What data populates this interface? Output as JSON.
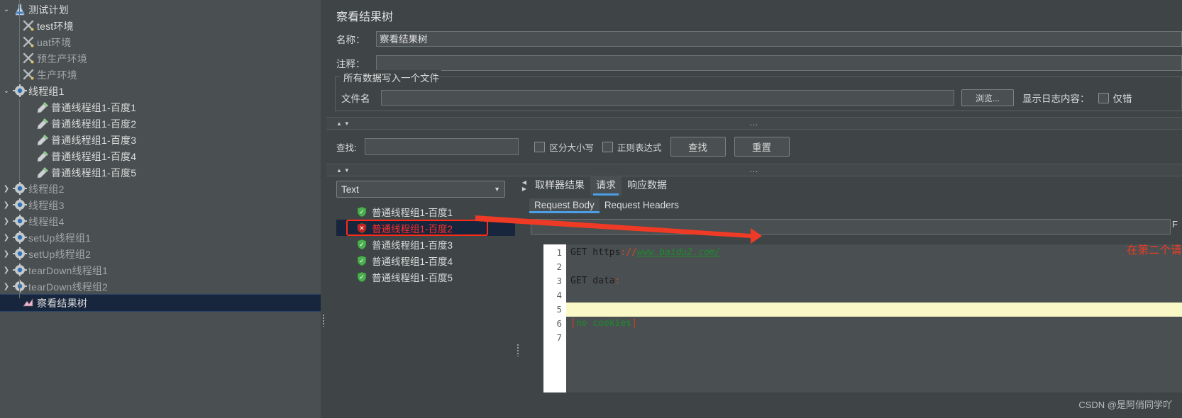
{
  "tree": {
    "items": [
      {
        "label": "测试计划",
        "icon": "flask-icon",
        "indent": 0,
        "twisty": "open",
        "dim": false,
        "selected": false
      },
      {
        "label": "test环境",
        "icon": "wrench-screwdriver-icon",
        "indent": 1,
        "twisty": "",
        "dim": false,
        "selected": false
      },
      {
        "label": "uat环境",
        "icon": "wrench-screwdriver-icon",
        "indent": 1,
        "twisty": "",
        "dim": true,
        "selected": false
      },
      {
        "label": "预生产环境",
        "icon": "wrench-screwdriver-icon",
        "indent": 1,
        "twisty": "",
        "dim": true,
        "selected": false
      },
      {
        "label": "生产环境",
        "icon": "wrench-screwdriver-icon",
        "indent": 1,
        "twisty": "",
        "dim": true,
        "selected": false
      },
      {
        "label": "线程组1",
        "icon": "gear-icon",
        "indent": 0,
        "twisty": "open",
        "dim": false,
        "selected": false
      },
      {
        "label": "普通线程组1-百度1",
        "icon": "pipette-icon",
        "indent": 2,
        "twisty": "",
        "dim": false,
        "selected": false
      },
      {
        "label": "普通线程组1-百度2",
        "icon": "pipette-icon",
        "indent": 2,
        "twisty": "",
        "dim": false,
        "selected": false
      },
      {
        "label": "普通线程组1-百度3",
        "icon": "pipette-icon",
        "indent": 2,
        "twisty": "",
        "dim": false,
        "selected": false
      },
      {
        "label": "普通线程组1-百度4",
        "icon": "pipette-icon",
        "indent": 2,
        "twisty": "",
        "dim": false,
        "selected": false
      },
      {
        "label": "普通线程组1-百度5",
        "icon": "pipette-icon",
        "indent": 2,
        "twisty": "",
        "dim": false,
        "selected": false
      },
      {
        "label": "线程组2",
        "icon": "gear-icon",
        "indent": 0,
        "twisty": "closed",
        "dim": true,
        "selected": false
      },
      {
        "label": "线程组3",
        "icon": "gear-icon",
        "indent": 0,
        "twisty": "closed",
        "dim": true,
        "selected": false
      },
      {
        "label": "线程组4",
        "icon": "gear-icon",
        "indent": 0,
        "twisty": "closed",
        "dim": true,
        "selected": false
      },
      {
        "label": "setUp线程组1",
        "icon": "gear-icon",
        "indent": 0,
        "twisty": "closed",
        "dim": true,
        "selected": false
      },
      {
        "label": "setUp线程组2",
        "icon": "gear-icon",
        "indent": 0,
        "twisty": "closed",
        "dim": true,
        "selected": false
      },
      {
        "label": "tearDown线程组1",
        "icon": "gear-icon",
        "indent": 0,
        "twisty": "closed",
        "dim": true,
        "selected": false
      },
      {
        "label": "tearDown线程组2",
        "icon": "gear-icon",
        "indent": 0,
        "twisty": "closed",
        "dim": true,
        "selected": false
      },
      {
        "label": "察看结果树",
        "icon": "result-tree-icon",
        "indent": 1,
        "twisty": "",
        "dim": false,
        "selected": true
      }
    ]
  },
  "panel": {
    "title": "察看结果树",
    "name_label": "名称：",
    "name_value": "察看结果树",
    "comment_label": "注释：",
    "comment_value": "",
    "groupbox_title": "所有数据写入一个文件",
    "filename_label": "文件名",
    "filename_value": "",
    "browse_button": "浏览...",
    "log_display_label": "显示日志内容：",
    "only_error_label": "仅错"
  },
  "search": {
    "label": "查找:",
    "value": "",
    "case_sensitive_label": "区分大小写",
    "regex_label": "正则表达式",
    "find_button": "查找",
    "reset_button": "重置",
    "ellipsis": "..."
  },
  "renderer": {
    "selected": "Text",
    "caret": "▼"
  },
  "results": [
    {
      "label": "普通线程组1-百度1",
      "status": "success"
    },
    {
      "label": "普通线程组1-百度2",
      "status": "error"
    },
    {
      "label": "普通线程组1-百度3",
      "status": "success"
    },
    {
      "label": "普通线程组1-百度4",
      "status": "success"
    },
    {
      "label": "普通线程组1-百度5",
      "status": "success"
    }
  ],
  "tabs": {
    "main": [
      {
        "label": "取样器结果",
        "active": false
      },
      {
        "label": "请求",
        "active": true
      },
      {
        "label": "响应数据",
        "active": false
      }
    ],
    "sub": [
      {
        "label": "Request Body",
        "active": true
      },
      {
        "label": "Request Headers",
        "active": false
      }
    ]
  },
  "request": {
    "find_label": "F",
    "input_value": "",
    "line_numbers": [
      "1",
      "2",
      "3",
      "4",
      "5",
      "6",
      "7"
    ],
    "lines": [
      {
        "n": "1",
        "text": "GET https://www.baidu2.com/",
        "type": "url",
        "highlight": false
      },
      {
        "n": "2",
        "text": "",
        "type": "plain",
        "highlight": false
      },
      {
        "n": "3",
        "text": "GET data:",
        "type": "kv",
        "highlight": false
      },
      {
        "n": "4",
        "text": "",
        "type": "plain",
        "highlight": false
      },
      {
        "n": "5",
        "text": "",
        "type": "plain",
        "highlight": true
      },
      {
        "n": "6",
        "text": "[no cookies]",
        "type": "cookie",
        "highlight": false
      },
      {
        "n": "7",
        "text": "",
        "type": "plain",
        "highlight": false
      }
    ],
    "url_method": "GET https",
    "url_colon": "://",
    "url_host": "www.baidu2.com/",
    "data_label": "GET data",
    "data_colon": ":",
    "cookie_open": "[",
    "cookie_text": "no cookies",
    "cookie_close": "]"
  },
  "annotation": {
    "text": "在第二个请求出错后，后面的请求继续执行",
    "color": "#ef3b25"
  },
  "watermark": "CSDN @是阿俏同学吖",
  "colors": {
    "accent": "#4b9fe8",
    "selection": "#17263c",
    "error": "#ff2b16",
    "success": "#4caf50",
    "highlight": "#fbf8c8"
  }
}
